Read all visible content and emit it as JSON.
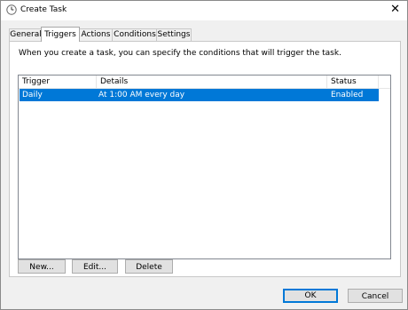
{
  "window": {
    "title": "Create Task",
    "close_label": "✕"
  },
  "tabs": [
    {
      "label": "General"
    },
    {
      "label": "Triggers",
      "selected": true
    },
    {
      "label": "Actions"
    },
    {
      "label": "Conditions"
    },
    {
      "label": "Settings"
    }
  ],
  "triggers_panel": {
    "description": "When you create a task, you can specify the conditions that will trigger the task.",
    "columns": {
      "trigger": "Trigger",
      "details": "Details",
      "status": "Status"
    },
    "rows": [
      {
        "trigger": "Daily",
        "details": "At 1:00 AM every day",
        "status": "Enabled",
        "selected": true
      }
    ]
  },
  "actions": {
    "new_label": "New...",
    "edit_label": "Edit...",
    "delete_label": "Delete"
  },
  "dialog_buttons": {
    "ok_label": "OK",
    "cancel_label": "Cancel"
  },
  "colors": {
    "selection": "#0078d7",
    "window_bg": "#f0f0f0",
    "ok_border": "#0078d7"
  },
  "icons": {
    "app": "task-scheduler-clock-icon",
    "close": "close-icon"
  }
}
